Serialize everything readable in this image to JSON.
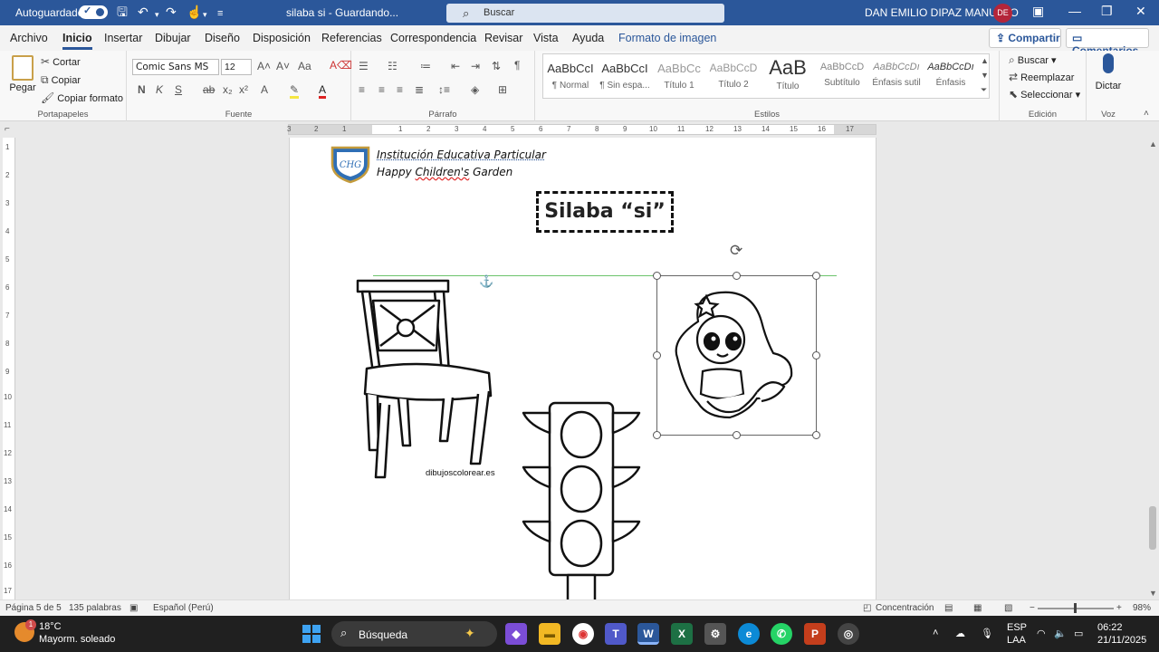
{
  "titlebar": {
    "autosave_label": "Autoguardado",
    "doc_title": "silaba si  -  Guardando...",
    "search_placeholder": "Buscar",
    "user_name": "DAN EMILIO DIPAZ MANUELO",
    "user_initials": "DE"
  },
  "menu": {
    "tabs": [
      "Archivo",
      "Inicio",
      "Insertar",
      "Dibujar",
      "Diseño",
      "Disposición",
      "Referencias",
      "Correspondencia",
      "Revisar",
      "Vista",
      "Ayuda",
      "Formato de imagen"
    ],
    "share_label": "Compartir",
    "comments_label": "Comentarios"
  },
  "ribbon": {
    "clipboard": {
      "paste": "Pegar",
      "cut": "Cortar",
      "copy": "Copiar",
      "format_painter": "Copiar formato",
      "label": "Portapapeles"
    },
    "font": {
      "name": "Comic Sans MS",
      "size": "12",
      "label": "Fuente"
    },
    "paragraph": {
      "label": "Párrafo"
    },
    "styles": {
      "items": [
        {
          "preview": "AaBbCcI",
          "name": "¶ Normal"
        },
        {
          "preview": "AaBbCcI",
          "name": "¶ Sin espa..."
        },
        {
          "preview": "AaBbCc",
          "name": "Título 1"
        },
        {
          "preview": "AaBbCcD",
          "name": "Título 2"
        },
        {
          "preview": "AaB",
          "name": "Título"
        },
        {
          "preview": "AaBbCcD",
          "name": "Subtítulo"
        },
        {
          "preview": "AaBbCcDı",
          "name": "Énfasis sutil"
        },
        {
          "preview": "AaBbCcDı",
          "name": "Énfasis"
        }
      ],
      "label": "Estilos"
    },
    "editing": {
      "find": "Buscar",
      "replace": "Reemplazar",
      "select": "Seleccionar",
      "label": "Edición"
    },
    "voice": {
      "dictate": "Dictar",
      "label": "Voz"
    }
  },
  "ruler": {
    "h_numbers": [
      "3",
      "2",
      "1",
      "1",
      "2",
      "3",
      "4",
      "5",
      "6",
      "7",
      "8",
      "9",
      "10",
      "11",
      "12",
      "13",
      "14",
      "15",
      "16",
      "17"
    ],
    "v_numbers": [
      "1",
      "2",
      "3",
      "4",
      "5",
      "6",
      "7",
      "8",
      "9",
      "10",
      "11",
      "12",
      "13",
      "14",
      "15",
      "16",
      "17"
    ]
  },
  "document": {
    "institution_line1": "Institución  Educativa Particular",
    "institution_line2_a": "Happy ",
    "institution_line2_b": "Children's",
    "institution_line2_c": " Garden",
    "logo_text": "CHG",
    "title": "Silaba “si”",
    "watermark": "dibujoscolorear.es"
  },
  "status": {
    "page": "Página 5 de 5",
    "words": "135 palabras",
    "language": "Español (Perú)",
    "focus": "Concentración",
    "zoom": "98%"
  },
  "taskbar": {
    "temperature": "18°C",
    "condition": "Mayorm. soleado",
    "search_label": "Búsqueda",
    "lang_top": "ESP",
    "lang_bottom": "LAA",
    "time": "06:22",
    "date": "21/11/2025",
    "weather_badge": "1"
  },
  "colors": {
    "word_blue": "#2b579a",
    "selection_green": "#6cc46c",
    "taskbar": "#202020"
  }
}
